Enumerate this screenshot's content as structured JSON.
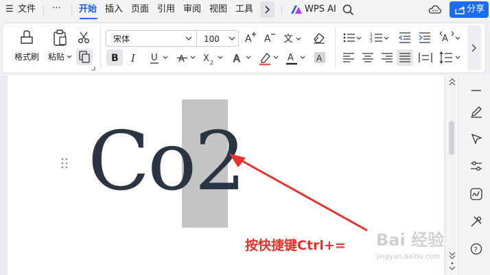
{
  "menubar": {
    "file_label": "文件",
    "more_label": "⋯",
    "tabs": [
      {
        "label": "开始",
        "active": true
      },
      {
        "label": "插入"
      },
      {
        "label": "页面"
      },
      {
        "label": "引用"
      },
      {
        "label": "审阅"
      },
      {
        "label": "视图"
      },
      {
        "label": "工具"
      }
    ],
    "wps_ai_label": "WPS AI",
    "share_label": "分享"
  },
  "ribbon": {
    "format_painter_label": "格式刷",
    "paste_label": "粘贴",
    "font_name": "宋体",
    "font_size": "100"
  },
  "document": {
    "text_before": "Co",
    "text_selected": "2",
    "annotation": "按快捷键Ctrl+="
  },
  "watermark": {
    "text": "Bai 经验",
    "url": "jingyan.baidu.com"
  },
  "colors": {
    "accent": "#1a62e8",
    "share_button": "#1a6cf0",
    "annotation": "#e8312b",
    "selection": "#c4c4c4",
    "doc_text": "#2b3443"
  }
}
